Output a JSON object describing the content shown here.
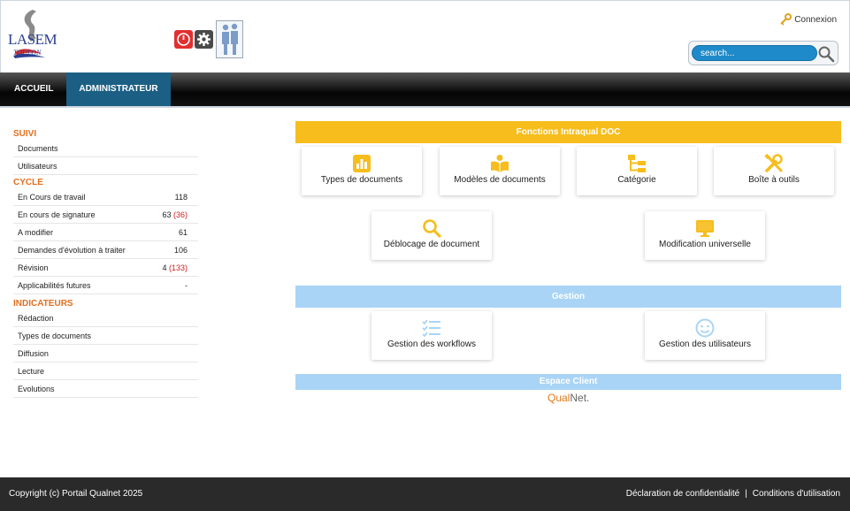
{
  "header": {
    "logo": {
      "name": "LASEM",
      "sub": "TOULON"
    },
    "connexion": "Connexion",
    "search": {
      "placeholder": "search..."
    }
  },
  "nav": {
    "items": [
      "ACCUEIL",
      "ADMINISTRATEUR"
    ],
    "active": "ADMINISTRATEUR"
  },
  "sidebar": {
    "suivi": {
      "title": "SUIVI",
      "items": [
        {
          "label": "Documents"
        },
        {
          "label": "Utilisateurs"
        }
      ]
    },
    "cycle": {
      "title": "CYCLE",
      "items": [
        {
          "label": "En Cours de travail",
          "count": "118",
          "extra": ""
        },
        {
          "label": "En cours de signature",
          "count": "63",
          "extra": "(36)"
        },
        {
          "label": "A modifier",
          "count": "61",
          "extra": ""
        },
        {
          "label": "Demandes d'évolution à traiter",
          "count": "106",
          "extra": ""
        },
        {
          "label": "Révision",
          "count": "4",
          "extra": "(133)"
        },
        {
          "label": "Applicabilités futures",
          "count": "-",
          "extra": ""
        }
      ]
    },
    "indicateurs": {
      "title": "INDICATEURS",
      "items": [
        {
          "label": "Rédaction"
        },
        {
          "label": "Types de documents"
        },
        {
          "label": "Diffusion"
        },
        {
          "label": "Lecture"
        },
        {
          "label": "Evolutions"
        }
      ]
    }
  },
  "main": {
    "fonctions": {
      "title": "Fonctions Intraqual DOC",
      "tiles": [
        {
          "label": "Types de documents",
          "icon": "chart-icon"
        },
        {
          "label": "Modèles de documents",
          "icon": "book-icon"
        },
        {
          "label": "Catégorie",
          "icon": "hierarchy-icon"
        },
        {
          "label": "Boîte à outils",
          "icon": "tools-icon"
        },
        {
          "label": "Déblocage de document",
          "icon": "magnifier-icon"
        },
        {
          "label": "Modification universelle",
          "icon": "monitor-icon"
        }
      ]
    },
    "gestion": {
      "title": "Gestion",
      "tiles": [
        {
          "label": "Gestion des workflows",
          "icon": "checklist-icon"
        },
        {
          "label": "Gestion des utilisateurs",
          "icon": "smiley-icon"
        }
      ]
    },
    "espace_client": {
      "title": "Espace Client",
      "brand_part1": "Qual",
      "brand_part2": "Net."
    }
  },
  "footer": {
    "copyright": "Copyright (c) Portail Qualnet 2025",
    "privacy": "Déclaration de confidentialité",
    "separator": "|",
    "terms": "Conditions d'utilisation"
  },
  "colors": {
    "accent_yellow": "#f6bd1c",
    "accent_blue": "#a9d4f6",
    "nav_active": "#1b5f84",
    "section_orange": "#e07020",
    "search_blue": "#1f8ac9"
  }
}
